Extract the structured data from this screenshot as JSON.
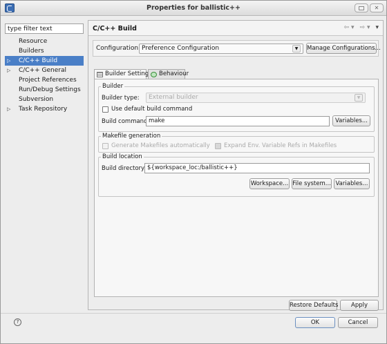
{
  "window": {
    "title": "Properties for ballistic++"
  },
  "left": {
    "filter_placeholder": "type filter text",
    "tree": [
      {
        "label": "Resource",
        "arrow": ""
      },
      {
        "label": "Builders",
        "arrow": ""
      },
      {
        "label": "C/C++ Build",
        "arrow": "▷",
        "selected": true
      },
      {
        "label": "C/C++ General",
        "arrow": "▷"
      },
      {
        "label": "Project References",
        "arrow": ""
      },
      {
        "label": "Run/Debug Settings",
        "arrow": ""
      },
      {
        "label": "Subversion",
        "arrow": ""
      },
      {
        "label": "Task Repository",
        "arrow": "▷"
      }
    ]
  },
  "header": {
    "title": "C/C++ Build",
    "back": "⇦ ▾",
    "forward": "⇨ ▾",
    "menu": "▾"
  },
  "config": {
    "label": "Configuration:",
    "value": "Preference Configuration",
    "manage": "Manage Configurations..."
  },
  "tabs": [
    {
      "label": "Builder Settings"
    },
    {
      "label": "Behaviour"
    }
  ],
  "builder": {
    "legend": "Builder",
    "type_label": "Builder type:",
    "type_value": "External builder",
    "use_default": "Use default build command",
    "cmd_label": "Build command:",
    "cmd_value": "make",
    "variables": "Variables..."
  },
  "makefile": {
    "legend": "Makefile generation",
    "generate": "Generate Makefiles automatically",
    "expand": "Expand Env. Variable Refs in Makefiles"
  },
  "location": {
    "legend": "Build location",
    "dir_label": "Build directory:",
    "dir_value": "${workspace_loc:/ballistic++}",
    "workspace": "Workspace...",
    "filesystem": "File system...",
    "variables": "Variables..."
  },
  "page_buttons": {
    "restore": "Restore Defaults",
    "apply": "Apply"
  },
  "dialog_buttons": {
    "help": "?",
    "ok": "OK",
    "cancel": "Cancel"
  }
}
